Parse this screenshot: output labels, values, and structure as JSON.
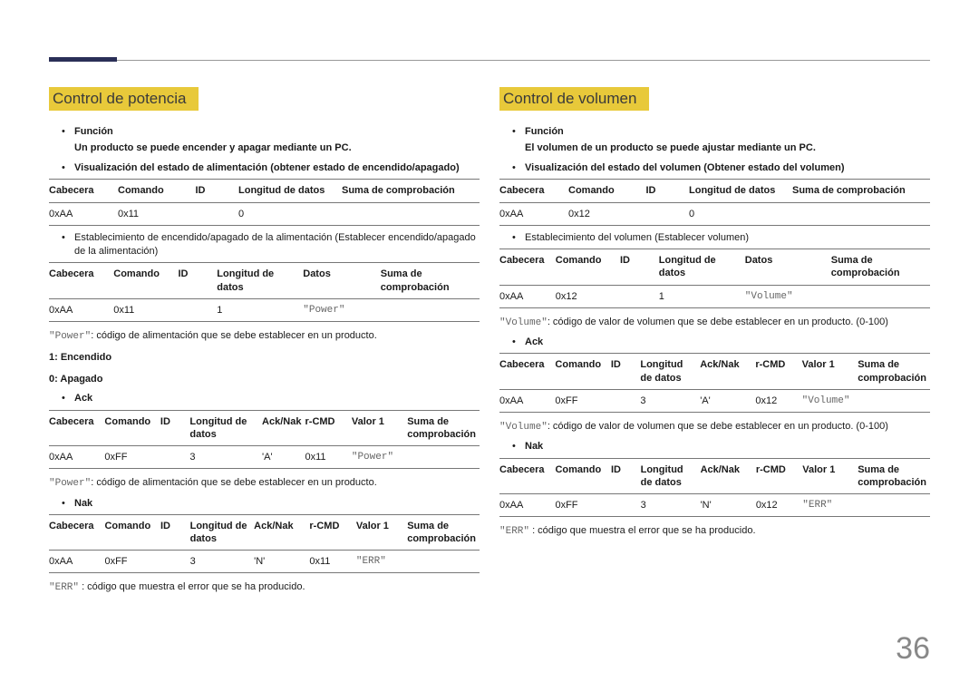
{
  "page_number": "36",
  "left": {
    "heading": "Control de potencia",
    "func_label": "Función",
    "func_desc": "Un producto se puede encender y apagar mediante un PC.",
    "view_label": "Visualización del estado de alimentación (obtener estado de encendido/apagado)",
    "t1_h": [
      "Cabecera",
      "Comando",
      "ID",
      "Longitud de datos",
      "Suma de comprobación"
    ],
    "t1_r": [
      "0xAA",
      "0x11",
      "",
      "0",
      ""
    ],
    "set_label": "Establecimiento de encendido/apagado de la alimentación (Establecer encendido/apagado de la alimentación)",
    "t2_h": [
      "Cabecera",
      "Comando",
      "ID",
      "Longitud de datos",
      "Datos",
      "Suma de comprobación"
    ],
    "t2_r": [
      "0xAA",
      "0x11",
      "",
      "1",
      "\"Power\"",
      ""
    ],
    "note1_pre": "\"Power\"",
    "note1_rest": ": código de alimentación que se debe establecer en un producto.",
    "on": "1: Encendido",
    "off": "0: Apagado",
    "ack_label": "Ack",
    "t3_h": [
      "Cabecera",
      "Comando",
      "ID",
      "Longitud de datos",
      "Ack/Nak",
      "r-CMD",
      "Valor 1",
      "Suma de comprobación"
    ],
    "t3_r": [
      "0xAA",
      "0xFF",
      "",
      "3",
      "'A'",
      "0x11",
      "\"Power\"",
      ""
    ],
    "note2_pre": "\"Power\"",
    "note2_rest": ": código de alimentación que se debe establecer en un producto.",
    "nak_label": "Nak",
    "t4_h": [
      "Cabecera",
      "Comando",
      "ID",
      "Longitud de datos",
      "Ack/Nak",
      "r-CMD",
      "Valor 1",
      "Suma de comprobación"
    ],
    "t4_r": [
      "0xAA",
      "0xFF",
      "",
      "3",
      "'N'",
      "0x11",
      "\"ERR\"",
      ""
    ],
    "err_pre": "\"ERR\"",
    "err_rest": " : código que muestra el error que se ha producido."
  },
  "right": {
    "heading": "Control de volumen",
    "func_label": "Función",
    "func_desc": "El volumen de un producto se puede ajustar mediante un PC.",
    "view_label": "Visualización del estado del volumen (Obtener estado del volumen)",
    "t1_h": [
      "Cabecera",
      "Comando",
      "ID",
      "Longitud de datos",
      "Suma de comprobación"
    ],
    "t1_r": [
      "0xAA",
      "0x12",
      "",
      "0",
      ""
    ],
    "set_label": "Establecimiento del volumen (Establecer volumen)",
    "t2_h": [
      "Cabecera",
      "Comando",
      "ID",
      "Longitud de datos",
      "Datos",
      "Suma de comprobación"
    ],
    "t2_r": [
      "0xAA",
      "0x12",
      "",
      "1",
      "\"Volume\"",
      ""
    ],
    "note1_pre": "\"Volume\"",
    "note1_rest": ": código de valor de volumen que se debe establecer en un producto. (0-100)",
    "ack_label": "Ack",
    "t3_h": [
      "Cabecera",
      "Comando",
      "ID",
      "Longitud de datos",
      "Ack/Nak",
      "r-CMD",
      "Valor 1",
      "Suma de comprobación"
    ],
    "t3_r": [
      "0xAA",
      "0xFF",
      "",
      "3",
      "'A'",
      "0x12",
      "\"Volume\"",
      ""
    ],
    "note2_pre": "\"Volume\"",
    "note2_rest": ": código de valor de volumen que se debe establecer en un producto. (0-100)",
    "nak_label": "Nak",
    "t4_h": [
      "Cabecera",
      "Comando",
      "ID",
      "Longitud de datos",
      "Ack/Nak",
      "r-CMD",
      "Valor 1",
      "Suma de comprobación"
    ],
    "t4_r": [
      "0xAA",
      "0xFF",
      "",
      "3",
      "'N'",
      "0x12",
      "\"ERR\"",
      ""
    ],
    "err_pre": "\"ERR\"",
    "err_rest": " : código que muestra el error que se ha producido."
  }
}
